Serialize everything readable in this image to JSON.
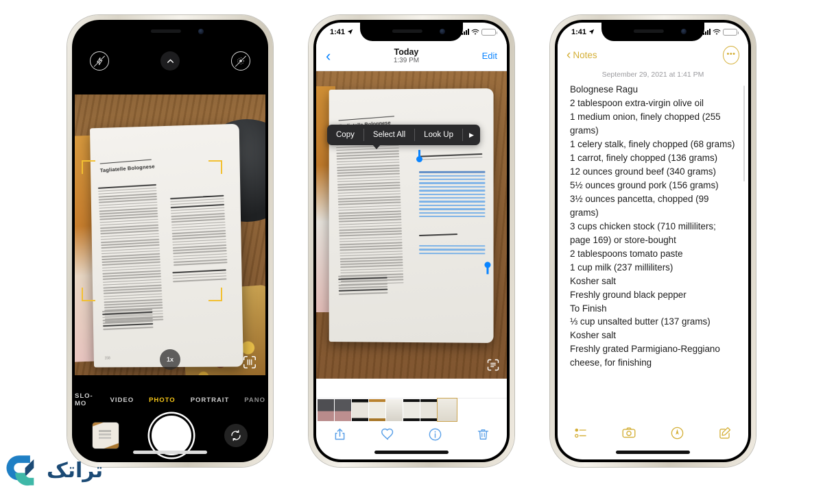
{
  "page": {
    "watermark_text": "تراتک"
  },
  "camera_phone": {
    "top_controls": [
      {
        "name": "flash-off",
        "label": ""
      },
      {
        "name": "chevron-up",
        "label": ""
      },
      {
        "name": "live-photo-off",
        "label": ""
      }
    ],
    "viewfinder": {
      "book_title": "Tagliatelle Bolognese",
      "page_number": "158",
      "zoom_label": "1x",
      "scan_icon": "document-scan-icon",
      "detected_corners_color": "#f2c032"
    },
    "modes": [
      {
        "label": "SLO-MO",
        "state": "inactive"
      },
      {
        "label": "VIDEO",
        "state": "inactive"
      },
      {
        "label": "PHOTO",
        "state": "active"
      },
      {
        "label": "PORTRAIT",
        "state": "inactive"
      },
      {
        "label": "PANO",
        "state": "dim"
      }
    ],
    "bottom": {
      "thumbnail_label": "last-photo-thumbnail",
      "shutter_label": "shutter-button",
      "flip_label": "flip-camera-button"
    },
    "accent_color": "#f5c518"
  },
  "photos_phone": {
    "status": {
      "time": "1:41",
      "battery_color": "#f0c246"
    },
    "nav": {
      "back_label": "‹",
      "title_day": "Today",
      "title_time": "1:39 PM",
      "edit_label": "Edit"
    },
    "context_menu": {
      "items": [
        "Copy",
        "Select All",
        "Look Up"
      ],
      "more_arrow": "▶"
    },
    "photo": {
      "book_title": "Tagliatelle Bolognese",
      "scan_icon": "live-text-icon",
      "selection_color": "#0a84ff"
    },
    "tabbar": [
      {
        "name": "share-icon",
        "label": "Share"
      },
      {
        "name": "heart-icon",
        "label": "Favorite"
      },
      {
        "name": "info-icon",
        "label": "Info"
      },
      {
        "name": "trash-icon",
        "label": "Delete"
      }
    ],
    "accent_color": "#0a84ff"
  },
  "notes_phone": {
    "status": {
      "time": "1:41",
      "battery_color": "#f0c246"
    },
    "nav": {
      "back_label": "Notes",
      "more_label": "•••"
    },
    "date_line": "September 29, 2021 at 1:41 PM",
    "note_lines": [
      "Bolognese Ragu",
      "2 tablespoon extra-virgin olive oil",
      "1 medium onion, finely chopped (255 grams)",
      "1 celery stalk, finely chopped (68 grams)",
      "1 carrot, finely chopped (136 grams)",
      "12 ounces ground beef (340 grams)",
      "5½ ounces ground pork (156 grams)",
      "3½ ounces pancetta, chopped (99 grams)",
      "3 cups chicken stock (710 milliliters; page 169) or store-bought",
      "2 tablespoons tomato paste",
      "1 cup milk (237 milliliters)",
      "Kosher salt",
      "Freshly ground black pepper",
      "To Finish",
      "⅓ cup unsalted butter (137 grams)",
      "Kosher salt",
      "Freshly grated Parmigiano-Reggiano cheese, for finishing"
    ],
    "tabbar": [
      {
        "name": "checklist-icon",
        "label": "Checklist"
      },
      {
        "name": "camera-icon",
        "label": "Camera"
      },
      {
        "name": "markup-icon",
        "label": "Markup"
      },
      {
        "name": "compose-icon",
        "label": "New Note"
      }
    ],
    "accent_color": "#d4af37"
  }
}
